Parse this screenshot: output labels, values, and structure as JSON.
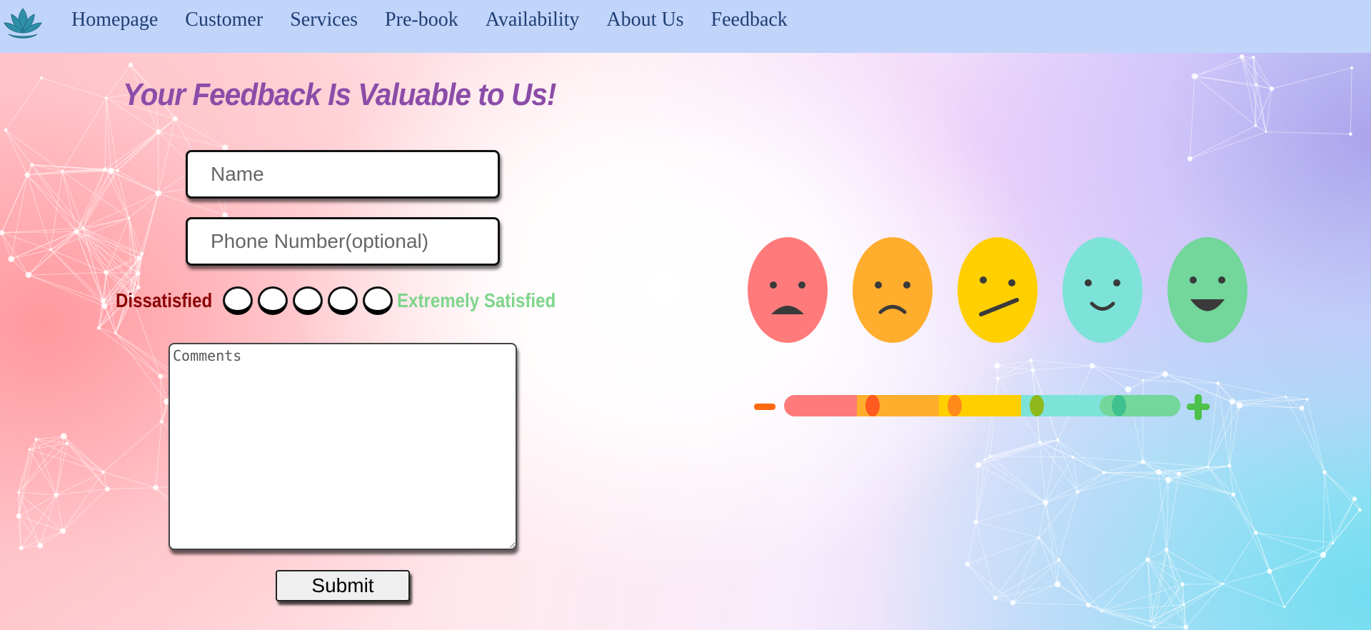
{
  "nav": {
    "logo_icon": "lotus-icon",
    "items": [
      {
        "label": "Homepage"
      },
      {
        "label": "Customer"
      },
      {
        "label": "Services"
      },
      {
        "label": "Pre-book"
      },
      {
        "label": "Availability"
      },
      {
        "label": "About Us"
      },
      {
        "label": "Feedback"
      }
    ]
  },
  "form": {
    "title": "Your Feedback Is Valuable to Us!",
    "name_placeholder": "Name",
    "phone_placeholder": "Phone Number(optional)",
    "rating": {
      "low_label": "Dissatisfied",
      "high_label": "Extremely Satisfied",
      "options": 5,
      "selected": null
    },
    "comments_placeholder": "Comments",
    "submit_label": "Submit"
  },
  "illustration": {
    "faces": [
      {
        "mood": "very-sad",
        "color": "#ff7b7b"
      },
      {
        "mood": "sad",
        "color": "#ffad2d"
      },
      {
        "mood": "neutral",
        "color": "#ffcf00"
      },
      {
        "mood": "happy",
        "color": "#7de3d8"
      },
      {
        "mood": "very-happy",
        "color": "#73d69b"
      }
    ],
    "scale_minus_color": "#ff6a10",
    "scale_plus_color": "#4cc14c"
  },
  "colors": {
    "nav_bg": "#c1d4fa",
    "nav_text": "#1f3f73",
    "title": "#8b4ca8",
    "dissatisfied": "#8b0000",
    "satisfied": "#7ed58b"
  }
}
